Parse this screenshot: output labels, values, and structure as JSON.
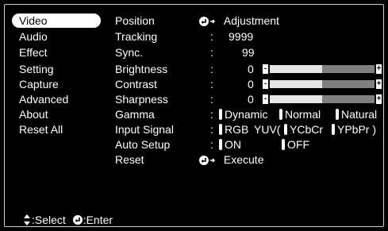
{
  "left_menu": [
    {
      "label": "Video",
      "selected": true
    },
    {
      "label": "Audio"
    },
    {
      "label": "Effect"
    },
    {
      "label": "Setting"
    },
    {
      "label": "Capture"
    },
    {
      "label": "Advanced"
    },
    {
      "label": "About"
    },
    {
      "label": "Reset All"
    }
  ],
  "rows": {
    "position": {
      "label": "Position",
      "value": "Adjustment"
    },
    "tracking": {
      "label": "Tracking",
      "colon": ":",
      "value": "9999"
    },
    "sync": {
      "label": "Sync.",
      "colon": ":",
      "value": "99"
    },
    "brightness": {
      "label": "Brightness",
      "colon": ":",
      "value": "0",
      "level": 0.5,
      "minus": "-",
      "plus": "+"
    },
    "contrast": {
      "label": "Contrast",
      "colon": ":",
      "value": "0",
      "level": 0.5,
      "minus": "-",
      "plus": "+"
    },
    "sharpness": {
      "label": "Sharpness",
      "colon": ":",
      "value": "0",
      "level": 0.5,
      "minus": "-",
      "plus": "+"
    },
    "gamma": {
      "label": "Gamma",
      "colon": ":",
      "options": [
        "Dynamic",
        "Normal",
        "Natural"
      ]
    },
    "input_signal": {
      "label": "Input Signal",
      "colon": ":",
      "options": [
        "RGB",
        "YUV(",
        "YCbCr",
        "YPbPr )"
      ]
    },
    "auto_setup": {
      "label": "Auto Setup",
      "colon": ":",
      "options": [
        "ON",
        "OFF"
      ]
    },
    "reset": {
      "label": "Reset",
      "value": "Execute"
    }
  },
  "footer": {
    "select_label": ":Select",
    "enter_label": ":Enter"
  },
  "icons": {
    "enter": "enter-arrow-icon",
    "select": "up-down-arrows-icon"
  },
  "colors": {
    "background": "#000000",
    "text": "#ffffff",
    "bar_fill": "#e6e6e6",
    "bar_track": "#808080"
  }
}
